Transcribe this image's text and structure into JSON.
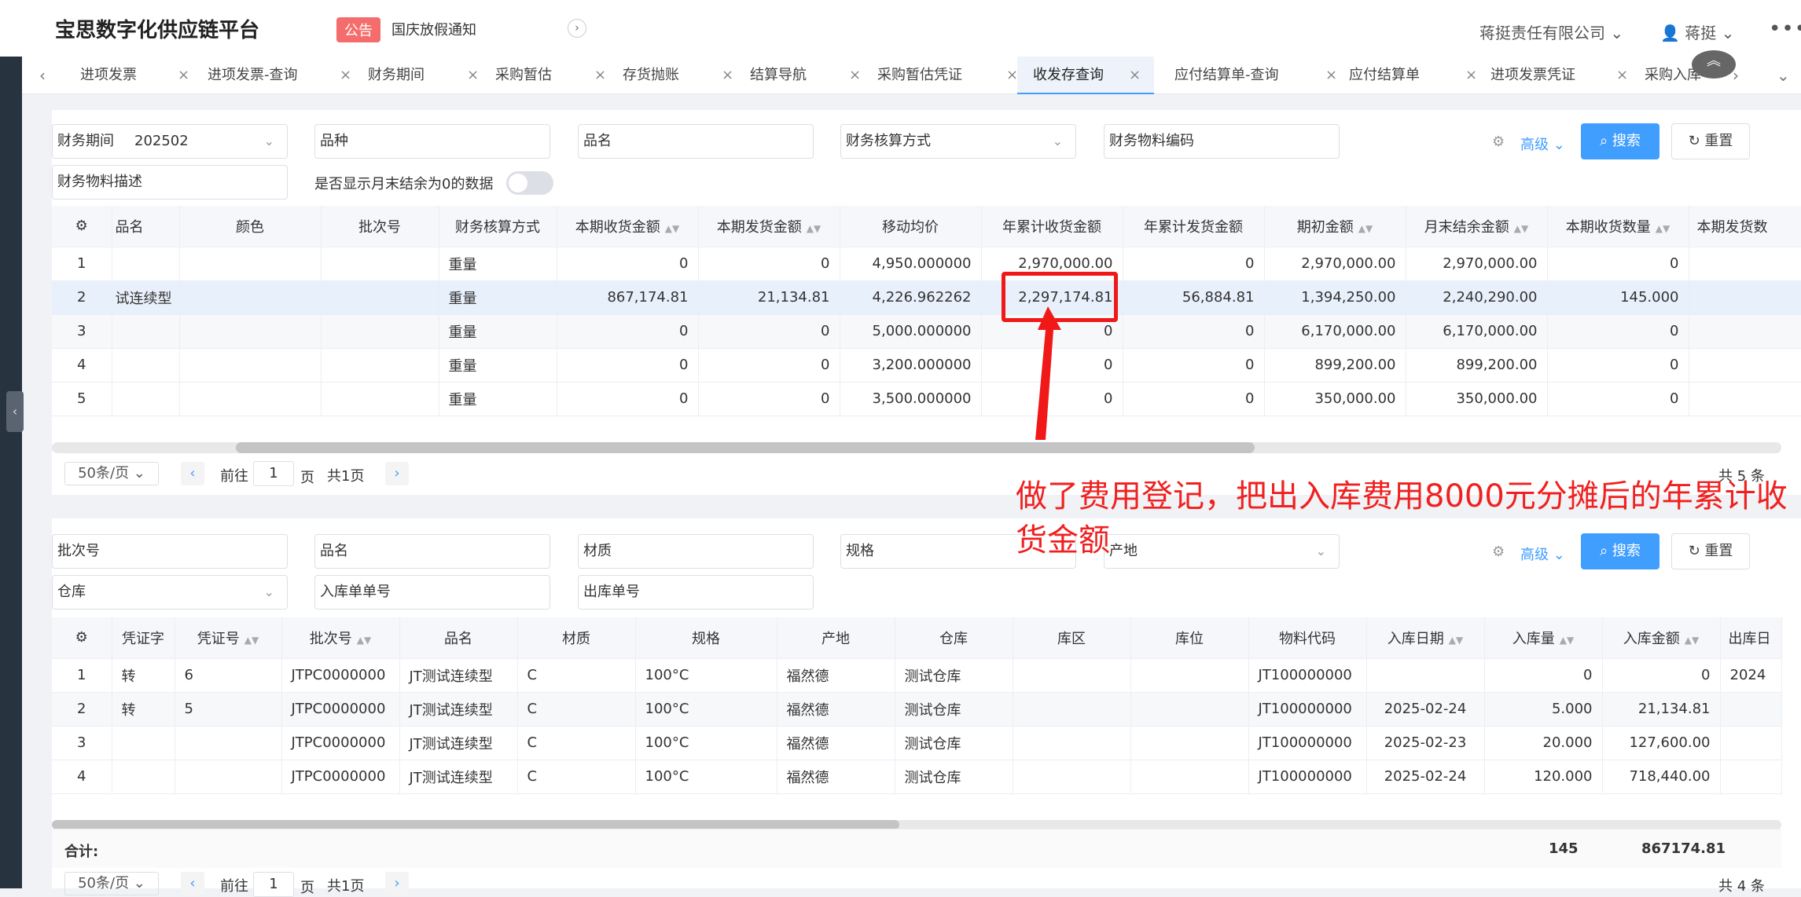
{
  "header": {
    "brand": "宝思数字化供应链平台",
    "notice_badge": "公告",
    "notice_text": "国庆放假通知",
    "company": "蒋挺责任有限公司",
    "user": "蒋挺",
    "more": "•••"
  },
  "tabs": [
    "进项发票",
    "进项发票-查询",
    "财务期间",
    "采购暂估",
    "存货抛账",
    "结算导航",
    "采购暂估凭证",
    "收发存查询",
    "应付结算单-查询",
    "应付结算单",
    "进项发票凭证",
    "采购入库"
  ],
  "active_tab_index": 7,
  "filters1": {
    "period_label": "财务期间",
    "period_value": "202502",
    "variety": "品种",
    "name": "品名",
    "accounting": "财务核算方式",
    "material_code": "财务物料编码",
    "material_desc": "财务物料描述",
    "toggle_label": "是否显示月末结余为0的数据",
    "advanced": "高级",
    "search": "搜索",
    "reset": "重置"
  },
  "table1": {
    "headers": [
      "品名",
      "颜色",
      "批次号",
      "财务核算方式",
      "本期收货金额",
      "本期发货金额",
      "移动均价",
      "年累计收货金额",
      "年累计发货金额",
      "期初金额",
      "月末结余金额",
      "本期收货数量",
      "本期发货数"
    ],
    "rows": [
      [
        "1",
        "",
        "",
        "",
        "重量",
        "0",
        "0",
        "4,950.000000",
        "2,970,000.00",
        "0",
        "2,970,000.00",
        "2,970,000.00",
        "0"
      ],
      [
        "2",
        "试连续型",
        "",
        "",
        "重量",
        "867,174.81",
        "21,134.81",
        "4,226.962262",
        "2,297,174.81",
        "56,884.81",
        "1,394,250.00",
        "2,240,290.00",
        "145.000"
      ],
      [
        "3",
        "",
        "",
        "",
        "重量",
        "0",
        "0",
        "5,000.000000",
        "0",
        "0",
        "6,170,000.00",
        "6,170,000.00",
        "0"
      ],
      [
        "4",
        "",
        "",
        "",
        "重量",
        "0",
        "0",
        "3,200.000000",
        "0",
        "0",
        "899,200.00",
        "899,200.00",
        "0"
      ],
      [
        "5",
        "",
        "",
        "",
        "重量",
        "0",
        "0",
        "3,500.000000",
        "0",
        "0",
        "350,000.00",
        "350,000.00",
        "0"
      ]
    ]
  },
  "pager1": {
    "size": "50条/页",
    "goto": "前往",
    "page": "1",
    "page_unit": "页",
    "total_pages": "共1页",
    "total": "共 5 条"
  },
  "annotation": "做了费用登记，把出入库费用8000元分摊后的年累计收货金额",
  "filters2": {
    "batch": "批次号",
    "name": "品名",
    "material": "材质",
    "spec": "规格",
    "warehouse": "仓库",
    "in_no": "入库单单号",
    "out_no": "出库单号",
    "origin": "产地",
    "advanced": "高级",
    "search": "搜索",
    "reset": "重置"
  },
  "table2": {
    "headers": [
      "凭证字",
      "凭证号",
      "批次号",
      "品名",
      "材质",
      "规格",
      "产地",
      "仓库",
      "库区",
      "库位",
      "物料代码",
      "入库日期",
      "入库量",
      "入库金额",
      "出库日"
    ],
    "rows": [
      [
        "1",
        "转",
        "6",
        "JTPC0000000",
        "JT测试连续型",
        "C",
        "100°C",
        "福然德",
        "测试仓库",
        "",
        "",
        "JT100000000",
        "",
        "0",
        "0",
        "2024"
      ],
      [
        "2",
        "转",
        "5",
        "JTPC0000000",
        "JT测试连续型",
        "C",
        "100°C",
        "福然德",
        "测试仓库",
        "",
        "",
        "JT100000000",
        "2025-02-24",
        "5.000",
        "21,134.81",
        ""
      ],
      [
        "3",
        "",
        "",
        "JTPC0000000",
        "JT测试连续型",
        "C",
        "100°C",
        "福然德",
        "测试仓库",
        "",
        "",
        "JT100000000",
        "2025-02-23",
        "20.000",
        "127,600.00",
        ""
      ],
      [
        "4",
        "",
        "",
        "JTPC0000000",
        "JT测试连续型",
        "C",
        "100°C",
        "福然德",
        "测试仓库",
        "",
        "",
        "JT100000000",
        "2025-02-24",
        "120.000",
        "718,440.00",
        ""
      ]
    ],
    "total_label": "合计:",
    "total_qty": "145",
    "total_amount": "867174.81"
  },
  "pager2": {
    "size": "50条/页",
    "goto": "前往",
    "page": "1",
    "page_unit": "页",
    "total_pages": "共1页",
    "total": "共 4 条"
  },
  "colors": {
    "accent": "#409eff",
    "annotation": "#f02020",
    "notice": "#f56c6c"
  }
}
